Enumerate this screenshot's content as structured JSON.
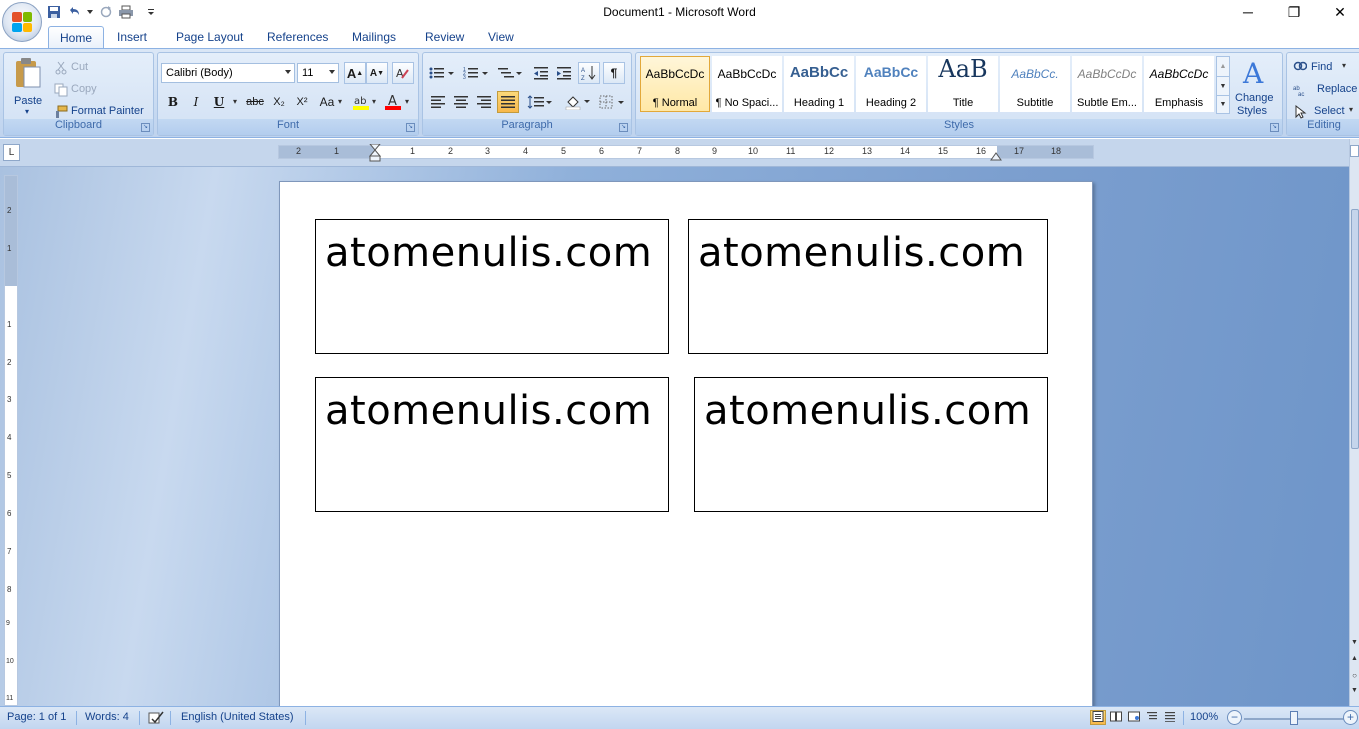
{
  "window": {
    "title": "Document1 - Microsoft Word",
    "minimize_glyph": "─",
    "restore_glyph": "❐",
    "close_glyph": "✕"
  },
  "tabs": [
    "Home",
    "Insert",
    "Page Layout",
    "References",
    "Mailings",
    "Review",
    "View"
  ],
  "ribbon": {
    "clipboard": {
      "label": "Clipboard",
      "paste": "Paste",
      "cut": "Cut",
      "copy": "Copy",
      "format_painter": "Format Painter"
    },
    "font": {
      "label": "Font",
      "font_name": "Calibri (Body)",
      "font_size": "11",
      "bold": "B",
      "italic": "I",
      "underline": "U",
      "strikethrough": "abc",
      "subscript": "X₂",
      "superscript": "X²",
      "change_case": "Aa",
      "grow": "A",
      "shrink": "A"
    },
    "paragraph": {
      "label": "Paragraph",
      "pilcrow": "¶"
    },
    "styles": {
      "label": "Styles",
      "items": [
        {
          "sample": "AaBbCcDc",
          "name": "¶ Normal"
        },
        {
          "sample": "AaBbCcDc",
          "name": "¶ No Spaci..."
        },
        {
          "sample": "AaBbCc",
          "name": "Heading 1"
        },
        {
          "sample": "AaBbCc",
          "name": "Heading 2"
        },
        {
          "sample": "AaB",
          "name": "Title"
        },
        {
          "sample": "AaBbCc.",
          "name": "Subtitle"
        },
        {
          "sample": "AaBbCcDc",
          "name": "Subtle Em..."
        },
        {
          "sample": "AaBbCcDc",
          "name": "Emphasis"
        }
      ],
      "change_styles_line1": "Change",
      "change_styles_line2": "Styles"
    },
    "editing": {
      "label": "Editing",
      "find": "Find",
      "replace": "Replace",
      "select": "Select"
    }
  },
  "ruler": {
    "tab_selector": "L",
    "numbers": [
      "2",
      "1",
      "1",
      "2",
      "3",
      "4",
      "5",
      "6",
      "7",
      "8",
      "9",
      "10",
      "11",
      "12",
      "13",
      "14",
      "15",
      "16",
      "17",
      "18"
    ],
    "vertical_numbers": [
      "2",
      "1",
      "1",
      "2",
      "3",
      "4",
      "5",
      "6",
      "7",
      "8",
      "9",
      "10",
      "11"
    ]
  },
  "document": {
    "textboxes": [
      "atomenulis.com",
      "atomenulis.com",
      "atomenulis.com",
      "atomenulis.com"
    ]
  },
  "status": {
    "page": "Page: 1 of 1",
    "words": "Words: 4",
    "language": "English (United States)",
    "zoom": "100%",
    "zoom_level_percent": 100
  },
  "colors": {
    "ribbon_bg": "#c6d9f1",
    "accent_text": "#15428b",
    "selected_style": "#ffe8a6",
    "highlight": "#ffff00",
    "font_color": "#ff0000"
  }
}
